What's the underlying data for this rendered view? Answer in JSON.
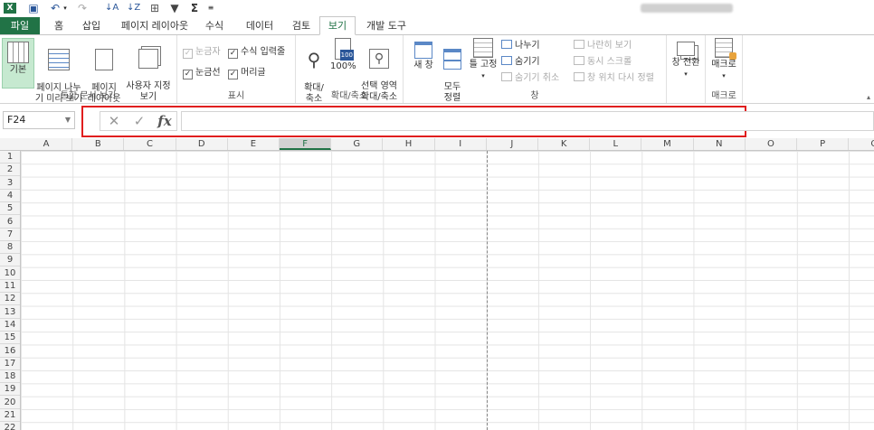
{
  "qat": {
    "icons": [
      "excel-icon",
      "save-icon",
      "undo-icon",
      "redo-icon",
      "sort-asc-icon",
      "sort-desc-icon",
      "table-icon",
      "filter-icon",
      "sum-icon",
      "customize-icon"
    ]
  },
  "tabs": [
    "파일",
    "홈",
    "삽입",
    "페이지 레이아웃",
    "수식",
    "데이터",
    "검토",
    "보기",
    "개발 도구"
  ],
  "ribbon": {
    "views": {
      "normal": "기본",
      "pagebreak": "페이지 나누\n기 미리 보기",
      "layout": "페이지\n레이아웃",
      "custom": "사용자 지정\n보기",
      "label": "통합 문서 보기"
    },
    "show": {
      "ruler": "눈금자",
      "formula_bar": "수식 입력줄",
      "gridlines": "눈금선",
      "headings": "머리글",
      "label": "표시"
    },
    "zoom": {
      "zoom": "확대/\n축소",
      "hundred": "100%",
      "selection": "선택 영역\n확대/축소",
      "label": "확대/축소"
    },
    "window": {
      "new": "새 창",
      "arrange": "모두\n정렬",
      "freeze": "틀 고정",
      "split": "나누기",
      "hide": "숨기기",
      "unhide": "숨기기 취소",
      "side": "나란히 보기",
      "sync": "동시 스크롤",
      "reset": "창 위치 다시 정렬",
      "switch": "창 전환",
      "label": "창"
    },
    "macro": {
      "macro": "매크로",
      "label": "매크로"
    }
  },
  "formula": {
    "namebox": "F24",
    "fx": "fx",
    "cancel": "✕",
    "enter": "✓",
    "value": ""
  },
  "columns": [
    "A",
    "B",
    "C",
    "D",
    "E",
    "F",
    "G",
    "H",
    "I",
    "J",
    "K",
    "L",
    "M",
    "N",
    "O",
    "P",
    "Q"
  ],
  "rows": [
    "1",
    "2",
    "3",
    "4",
    "5",
    "6",
    "7",
    "8",
    "9",
    "10",
    "11",
    "12",
    "13",
    "14",
    "15",
    "16",
    "17",
    "18",
    "19",
    "20",
    "21",
    "22"
  ]
}
